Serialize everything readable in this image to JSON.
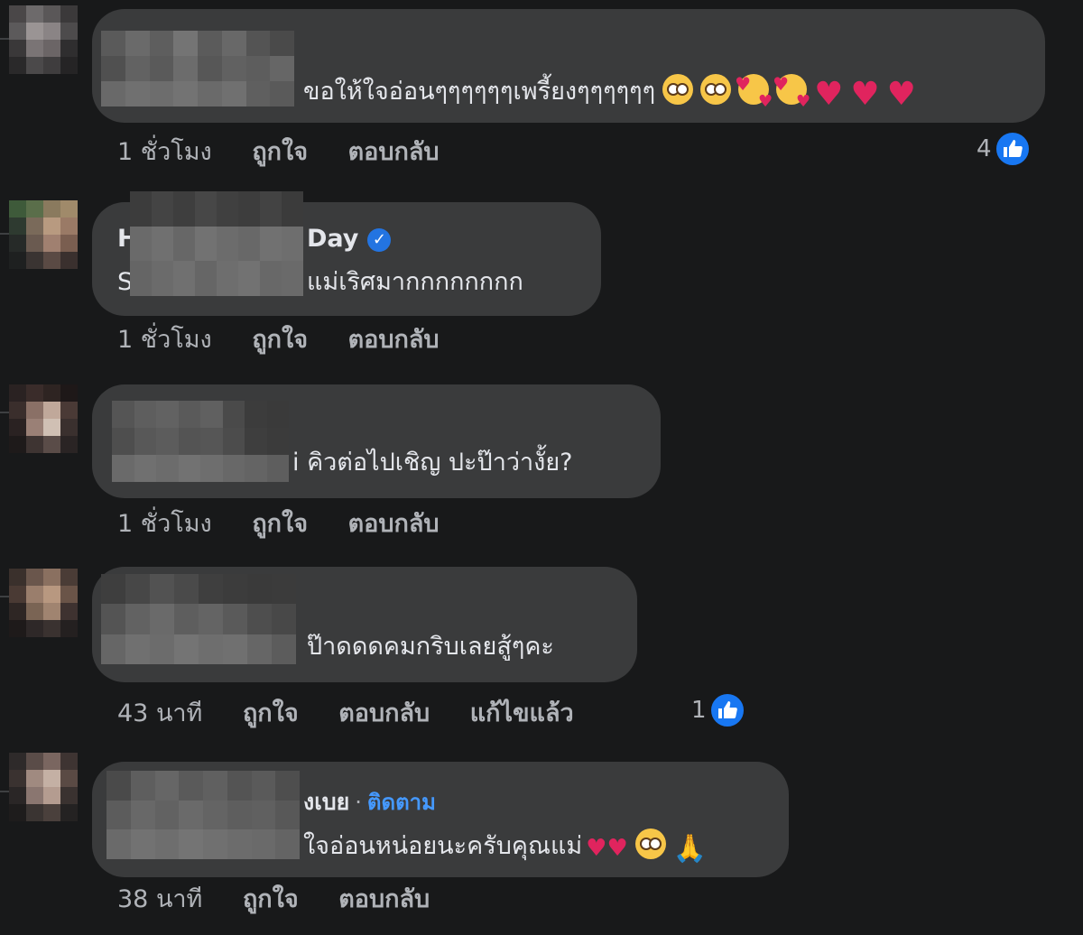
{
  "comments": [
    {
      "name": "",
      "text": "ขอให้ใจอ่อนๆๆๆๆๆๆเพรี้ยงๆๆๆๆๆๆ",
      "emojis": [
        "pleading-face",
        "pleading-face",
        "smiling-face-with-hearts",
        "smiling-face-with-hearts",
        "red-heart",
        "red-heart",
        "red-heart"
      ],
      "time": "1 ชั่วโมง",
      "like": "ถูกใจ",
      "reply": "ตอบกลับ",
      "reaction_count": "4"
    },
    {
      "name_start": "H",
      "name_end": "Day",
      "verified": "✓",
      "text_start": "S",
      "text": "แม่เริศมากกกกกกกก",
      "time": "1 ชั่วโมง",
      "like": "ถูกใจ",
      "reply": "ตอบกลับ"
    },
    {
      "text": "i คิวต่อไปเชิญ ปะป๊าว่างั้ย?",
      "time": "1 ชั่วโมง",
      "like": "ถูกใจ",
      "reply": "ตอบกลับ"
    },
    {
      "text": "ป๊าดดดคมกริบเลยสู้ๆคะ",
      "time": "43 นาที",
      "like": "ถูกใจ",
      "reply": "ตอบกลับ",
      "edited": "แก้ไขแล้ว",
      "reaction_count": "1"
    },
    {
      "name_end": "งเบย",
      "separator": "·",
      "follow": "ติดตาม",
      "text": "ใจอ่อนหน่อยนะครับคุณแม่",
      "emojis": [
        "two-hearts",
        "pleading-face",
        "folded-hands"
      ],
      "time": "38 นาที",
      "like": "ถูกใจ",
      "reply": "ตอบกลับ"
    }
  ],
  "colors": {
    "background": "#18191a",
    "bubble": "#3a3b3c",
    "text": "#e4e6eb",
    "meta": "#b0b3b8",
    "like_blue": "#1877f2",
    "follow_blue": "#4599ff"
  }
}
